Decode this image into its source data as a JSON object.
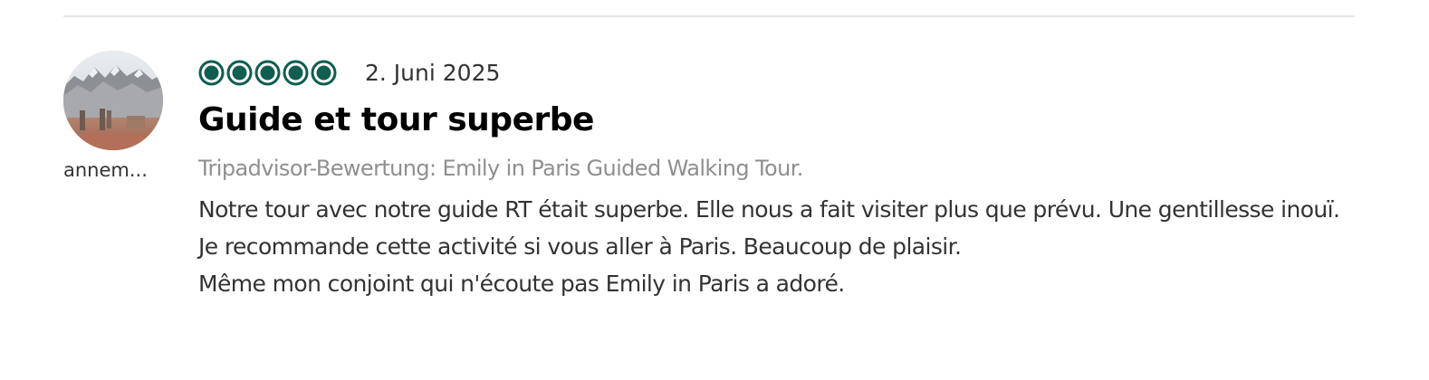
{
  "review": {
    "author": {
      "name": "annem..."
    },
    "rating": {
      "value": 5,
      "max": 5,
      "color": "#00aa6c",
      "fill_color": "#0f5e4f"
    },
    "date": "2. Juni 2025",
    "title": "Guide et tour superbe",
    "source": "Tripadvisor-Bewertung: Emily in Paris Guided Walking Tour.",
    "body_lines": [
      "Notre tour avec notre guide RT était superbe. Elle nous a fait visiter plus que prévu. Une gentillesse inouï.",
      "Je recommande cette activité si vous aller à Paris. Beaucoup de plaisir.",
      "Même mon conjoint qui n'écoute pas Emily in Paris a adoré."
    ]
  }
}
